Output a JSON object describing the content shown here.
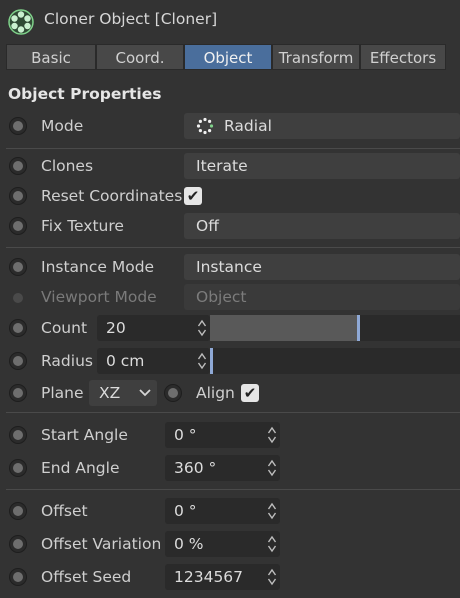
{
  "header": {
    "title": "Cloner Object [Cloner]",
    "icon": "cloner-icon"
  },
  "tabs": [
    {
      "label": "Basic",
      "active": false
    },
    {
      "label": "Coord.",
      "active": false
    },
    {
      "label": "Object",
      "active": true
    },
    {
      "label": "Transform",
      "active": false
    },
    {
      "label": "Effectors",
      "active": false
    }
  ],
  "section": {
    "title": "Object Properties"
  },
  "props": {
    "mode": {
      "label": "Mode",
      "value": "Radial",
      "icon": "radial-dots-icon"
    },
    "clones": {
      "label": "Clones",
      "value": "Iterate"
    },
    "reset_coordinates": {
      "label": "Reset Coordinates",
      "checked": true
    },
    "fix_texture": {
      "label": "Fix Texture",
      "value": "Off"
    },
    "instance_mode": {
      "label": "Instance Mode",
      "value": "Instance"
    },
    "viewport_mode": {
      "label": "Viewport Mode",
      "value": "Object",
      "disabled": true
    },
    "count": {
      "label": "Count",
      "value": "20",
      "slider_fraction": 0.6
    },
    "radius": {
      "label": "Radius",
      "value": "0 cm",
      "slider_fraction": 0.0
    },
    "plane": {
      "label": "Plane",
      "value": "XZ",
      "options_visible": [
        "XZ"
      ]
    },
    "align": {
      "label": "Align",
      "checked": true
    },
    "start_angle": {
      "label": "Start Angle",
      "value": "0 °"
    },
    "end_angle": {
      "label": "End Angle",
      "value": "360 °"
    },
    "offset": {
      "label": "Offset",
      "value": "0 °"
    },
    "offset_variation": {
      "label": "Offset Variation",
      "value": "0 %"
    },
    "offset_seed": {
      "label": "Offset Seed",
      "value": "1234567"
    }
  },
  "colors": {
    "background": "#333333",
    "active_tab": "#4a6e9c",
    "slider_handle": "#8fa9d6",
    "cloner_icon": "#7fd18a"
  }
}
